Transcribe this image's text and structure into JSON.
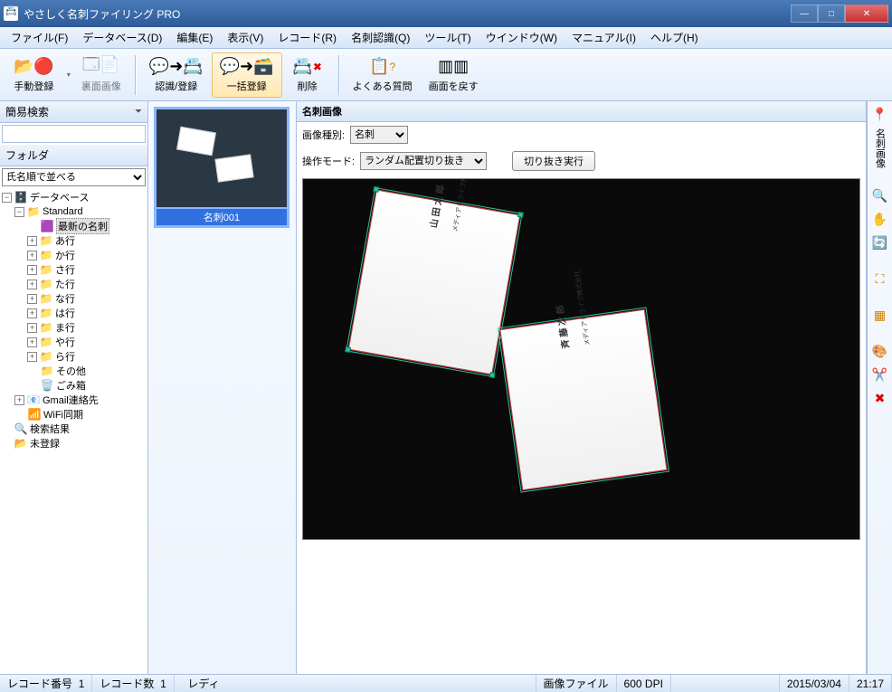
{
  "window": {
    "title": "やさしく名刺ファイリング PRO"
  },
  "menu": {
    "file": "ファイル(F)",
    "database": "データベース(D)",
    "edit": "編集(E)",
    "view": "表示(V)",
    "record": "レコード(R)",
    "recognize": "名刺認識(Q)",
    "tool": "ツール(T)",
    "window": "ウインドウ(W)",
    "manual": "マニュアル(I)",
    "help": "ヘルプ(H)"
  },
  "toolbar": {
    "manual_reg": "手動登録",
    "back_image": "裏面画像",
    "recognize_reg": "認識/登録",
    "batch_reg": "一括登録",
    "delete": "削除",
    "faq": "よくある質問",
    "reset_screen": "画面を戻す"
  },
  "leftpanel": {
    "search_hdr": "簡易検索",
    "folder_hdr": "フォルダ",
    "sort_label": "氏名順で並べる",
    "tree": {
      "root": "データベース",
      "standard": "Standard",
      "latest": "最新の名刺",
      "a": "あ行",
      "ka": "か行",
      "sa": "さ行",
      "ta": "た行",
      "na": "な行",
      "ha": "は行",
      "ma": "ま行",
      "ya": "や行",
      "ra": "ら行",
      "other": "その他",
      "trash": "ごみ箱",
      "gmail": "Gmail連絡先",
      "wifi": "WiFi同期",
      "search_result": "検索結果",
      "unregistered": "未登録"
    }
  },
  "thumb": {
    "label": "名刺001"
  },
  "detail": {
    "hdr": "名刺画像",
    "imgtype_label": "画像種別:",
    "imgtype_value": "名刺",
    "opmode_label": "操作モード:",
    "opmode_value": "ランダム配置切り抜き",
    "crop_btn": "切り抜き実行"
  },
  "cards": {
    "card1": {
      "name": "山 田 太 郎",
      "company": "メディアドライブ株式会社"
    },
    "card2": {
      "name": "斉 藤 次 郎",
      "company": "メディアドライブ株式会社"
    }
  },
  "sidestrip": {
    "label": "名刺画像"
  },
  "status": {
    "rec_no_label": "レコード番号",
    "rec_no": "1",
    "rec_count_label": "レコード数",
    "rec_count": "1",
    "ready": "レディ",
    "file_label": "画像ファイル",
    "dpi": "600 DPI",
    "date": "2015/03/04",
    "time": "21:17"
  }
}
